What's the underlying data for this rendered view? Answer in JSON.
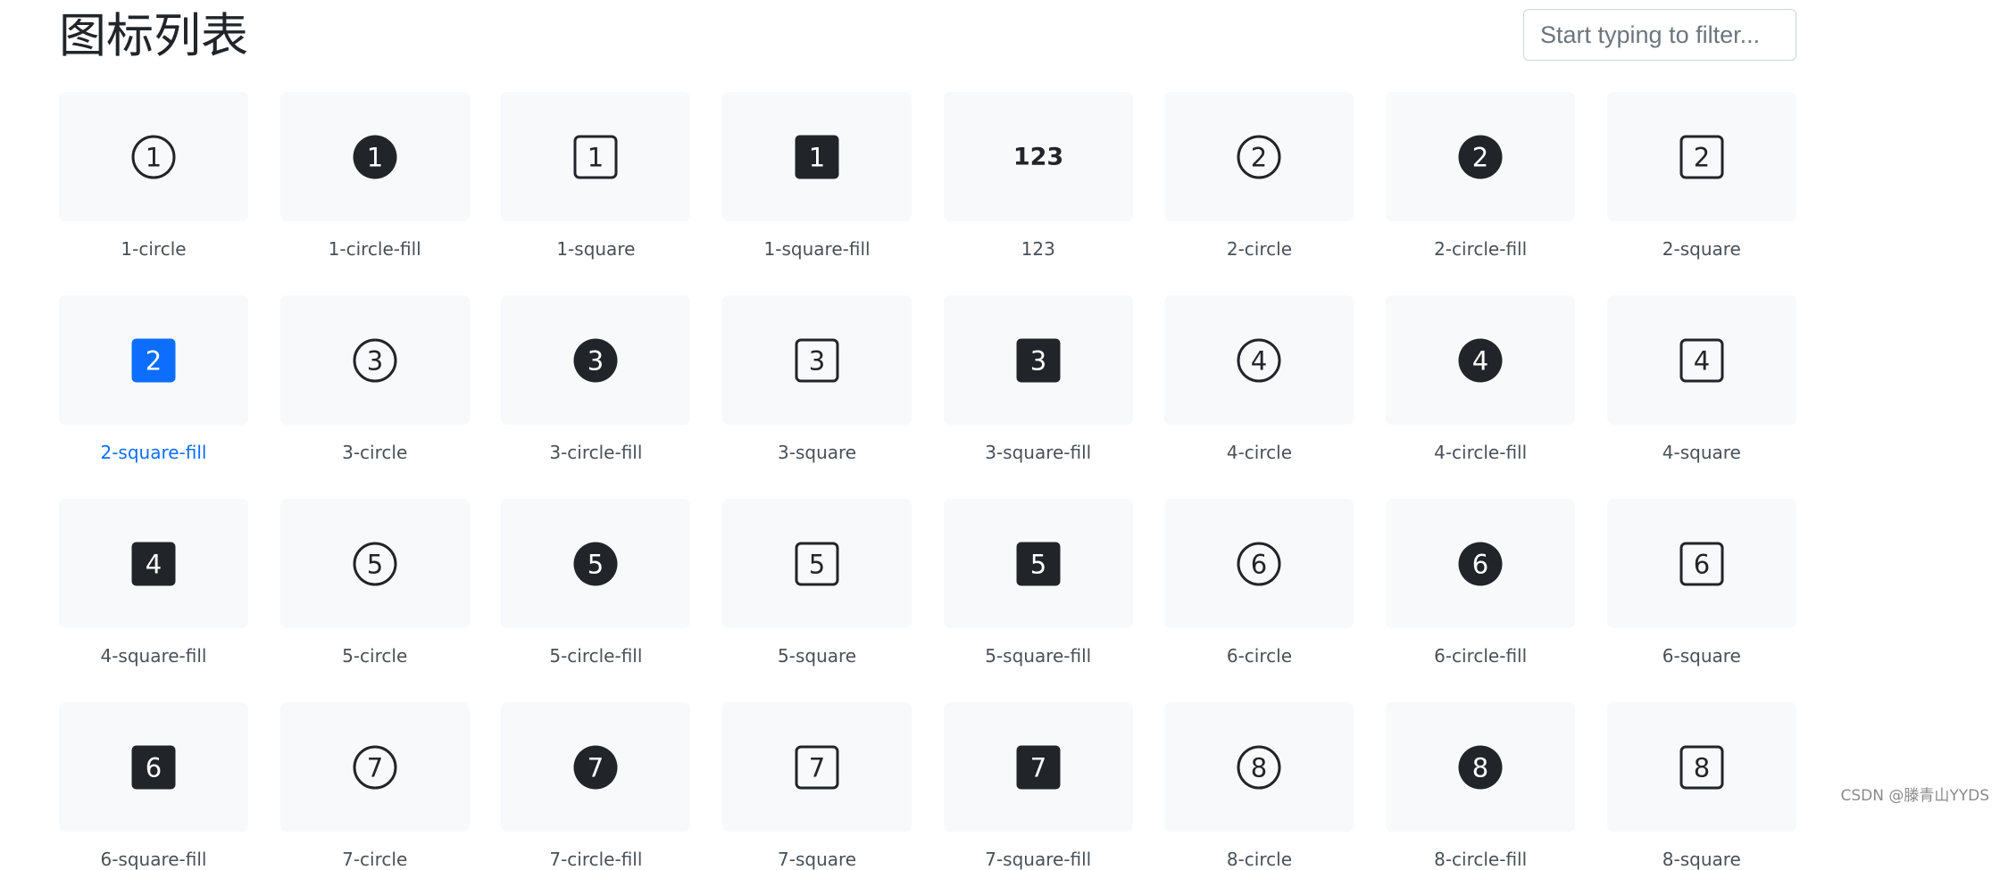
{
  "header": {
    "title": "图标列表"
  },
  "filter": {
    "placeholder": "Start typing to filter..."
  },
  "colors": {
    "icon": "#212529",
    "active": "#0d6efd",
    "tile_bg": "#f8f9fa",
    "label": "#495057"
  },
  "icons": [
    {
      "name": "1-circle",
      "glyph": "1",
      "shape": "circle",
      "active": false
    },
    {
      "name": "1-circle-fill",
      "glyph": "1",
      "shape": "circle-fill",
      "active": false
    },
    {
      "name": "1-square",
      "glyph": "1",
      "shape": "square",
      "active": false
    },
    {
      "name": "1-square-fill",
      "glyph": "1",
      "shape": "square-fill",
      "active": false
    },
    {
      "name": "123",
      "glyph": "123",
      "shape": "text",
      "active": false
    },
    {
      "name": "2-circle",
      "glyph": "2",
      "shape": "circle",
      "active": false
    },
    {
      "name": "2-circle-fill",
      "glyph": "2",
      "shape": "circle-fill",
      "active": false
    },
    {
      "name": "2-square",
      "glyph": "2",
      "shape": "square",
      "active": false
    },
    {
      "name": "2-square-fill",
      "glyph": "2",
      "shape": "square-fill",
      "active": true
    },
    {
      "name": "3-circle",
      "glyph": "3",
      "shape": "circle",
      "active": false
    },
    {
      "name": "3-circle-fill",
      "glyph": "3",
      "shape": "circle-fill",
      "active": false
    },
    {
      "name": "3-square",
      "glyph": "3",
      "shape": "square",
      "active": false
    },
    {
      "name": "3-square-fill",
      "glyph": "3",
      "shape": "square-fill",
      "active": false
    },
    {
      "name": "4-circle",
      "glyph": "4",
      "shape": "circle",
      "active": false
    },
    {
      "name": "4-circle-fill",
      "glyph": "4",
      "shape": "circle-fill",
      "active": false
    },
    {
      "name": "4-square",
      "glyph": "4",
      "shape": "square",
      "active": false
    },
    {
      "name": "4-square-fill",
      "glyph": "4",
      "shape": "square-fill",
      "active": false
    },
    {
      "name": "5-circle",
      "glyph": "5",
      "shape": "circle",
      "active": false
    },
    {
      "name": "5-circle-fill",
      "glyph": "5",
      "shape": "circle-fill",
      "active": false
    },
    {
      "name": "5-square",
      "glyph": "5",
      "shape": "square",
      "active": false
    },
    {
      "name": "5-square-fill",
      "glyph": "5",
      "shape": "square-fill",
      "active": false
    },
    {
      "name": "6-circle",
      "glyph": "6",
      "shape": "circle",
      "active": false
    },
    {
      "name": "6-circle-fill",
      "glyph": "6",
      "shape": "circle-fill",
      "active": false
    },
    {
      "name": "6-square",
      "glyph": "6",
      "shape": "square",
      "active": false
    },
    {
      "name": "6-square-fill",
      "glyph": "6",
      "shape": "square-fill",
      "active": false
    },
    {
      "name": "7-circle",
      "glyph": "7",
      "shape": "circle",
      "active": false
    },
    {
      "name": "7-circle-fill",
      "glyph": "7",
      "shape": "circle-fill",
      "active": false
    },
    {
      "name": "7-square",
      "glyph": "7",
      "shape": "square",
      "active": false
    },
    {
      "name": "7-square-fill",
      "glyph": "7",
      "shape": "square-fill",
      "active": false
    },
    {
      "name": "8-circle",
      "glyph": "8",
      "shape": "circle",
      "active": false
    },
    {
      "name": "8-circle-fill",
      "glyph": "8",
      "shape": "circle-fill",
      "active": false
    },
    {
      "name": "8-square",
      "glyph": "8",
      "shape": "square",
      "active": false
    }
  ],
  "watermark": "CSDN @滕青山YYDS"
}
